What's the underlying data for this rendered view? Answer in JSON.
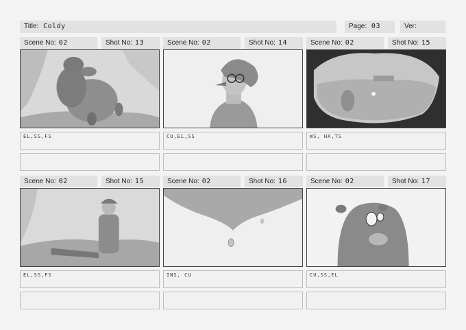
{
  "header": {
    "title_label": "Title:",
    "title_value": "Coldy",
    "page_label": "Page:",
    "page_value": "03",
    "ver_label": "Ver:",
    "ver_value": ""
  },
  "panels": [
    {
      "scene_label": "Scene No:",
      "scene_value": "02",
      "shot_label": "Shot No:",
      "shot_value": "13",
      "note": "EL,SS,FS",
      "note2": ""
    },
    {
      "scene_label": "Scene No:",
      "scene_value": "02",
      "shot_label": "Shot No:",
      "shot_value": "14",
      "note": "CU,EL,SS",
      "note2": ""
    },
    {
      "scene_label": "Scene No:",
      "scene_value": "02",
      "shot_label": "Shot No:",
      "shot_value": "15",
      "note": "WS, HA,TS",
      "note2": ""
    },
    {
      "scene_label": "Scene No:",
      "scene_value": "02",
      "shot_label": "Shot No:",
      "shot_value": "15",
      "note": "EL,SS,FS",
      "note2": ""
    },
    {
      "scene_label": "Scene No:",
      "scene_value": "02",
      "shot_label": "Shot No:",
      "shot_value": "16",
      "note": "INS, CU",
      "note2": ""
    },
    {
      "scene_label": "Scene No:",
      "scene_value": "02",
      "shot_label": "Shot No:",
      "shot_value": "17",
      "note": "CU,SS,EL",
      "note2": ""
    }
  ]
}
